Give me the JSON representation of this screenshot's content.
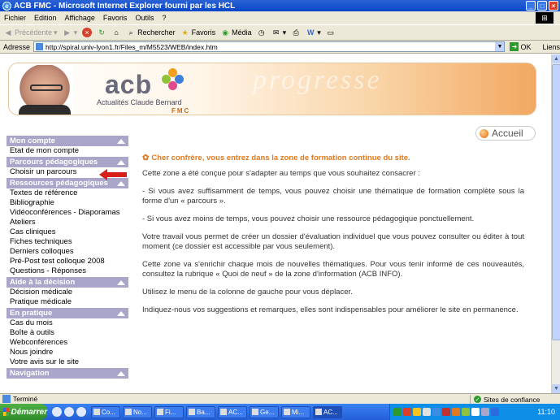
{
  "window": {
    "title": "ACB FMC - Microsoft Internet Explorer fourni par les HCL"
  },
  "menu": [
    "Fichier",
    "Edition",
    "Affichage",
    "Favoris",
    "Outils",
    "?"
  ],
  "toolbar": {
    "back_label": "Précédente",
    "search_label": "Rechercher",
    "favorites_label": "Favoris",
    "media_label": "Média"
  },
  "address": {
    "label": "Adresse",
    "url": "http://spiral.univ-lyon1.fr/Files_m/M5523/WEB/index.htm",
    "go_label": "OK",
    "links_label": "Liens"
  },
  "banner": {
    "logo_text": "acb",
    "subtitle": "Actualités Claude Bernard",
    "fmc": "FMC",
    "watermark": "progresse"
  },
  "accueil_label": "Accueil",
  "sidebar": [
    {
      "title": "Mon compte",
      "items": [
        "Etat de mon compte"
      ]
    },
    {
      "title": "Parcours pédagogiques",
      "items": [
        "Choisir un parcours"
      ]
    },
    {
      "title": "Ressources pédagogiques",
      "items": [
        "Textes de référence",
        "Bibliographie",
        "Vidéoconférences - Diaporamas",
        "Ateliers",
        "Cas cliniques",
        "Fiches techniques",
        "Derniers colloques",
        "Pré-Post test colloque 2008",
        "Questions - Réponses"
      ]
    },
    {
      "title": "Aide à la décision",
      "items": [
        "Décision médicale",
        "Pratique médicale"
      ]
    },
    {
      "title": "En pratique",
      "items": [
        "Cas du mois",
        "Boîte à outils",
        "Webconférences",
        "Nous joindre",
        "Votre avis sur le site"
      ]
    },
    {
      "title": "Navigation",
      "items": []
    }
  ],
  "content": {
    "intro": "Cher confrère, vous entrez dans la zone de formation continue du site.",
    "paragraphs": [
      "Cette zone a été conçue pour s'adapter au temps que vous souhaitez consacrer :",
      "- Si vous avez suffisamment de temps, vous pouvez choisir une thématique de formation complète sous la forme d'un « parcours ».",
      "- Si vous avez moins de temps, vous pouvez choisir une ressource pédagogique ponctuellement.",
      "Votre travail vous permet de créer un dossier d'évaluation individuel que vous pouvez consulter ou éditer à tout moment (ce dossier est accessible par vous seulement).",
      "Cette zone va s'enrichir chaque mois de nouvelles thématiques. Pour vous tenir informé de ces nouveautés, consultez la rubrique « Quoi de neuf » de la zone d'information (ACB INFO).",
      "Utilisez le menu de la colonne de gauche pour vous déplacer.",
      "Indiquez-nous vos suggestions et remarques, elles sont indispensables pour améliorer le site en permanence."
    ]
  },
  "status": {
    "text": "Terminé",
    "zone": "Sites de confiance"
  },
  "taskbar": {
    "start_label": "Démarrer",
    "tasks": [
      "Co...",
      "No...",
      "Fi...",
      "Ba...",
      "AC...",
      "Ge...",
      "Mi...",
      "AC..."
    ],
    "clock": "11:10"
  }
}
